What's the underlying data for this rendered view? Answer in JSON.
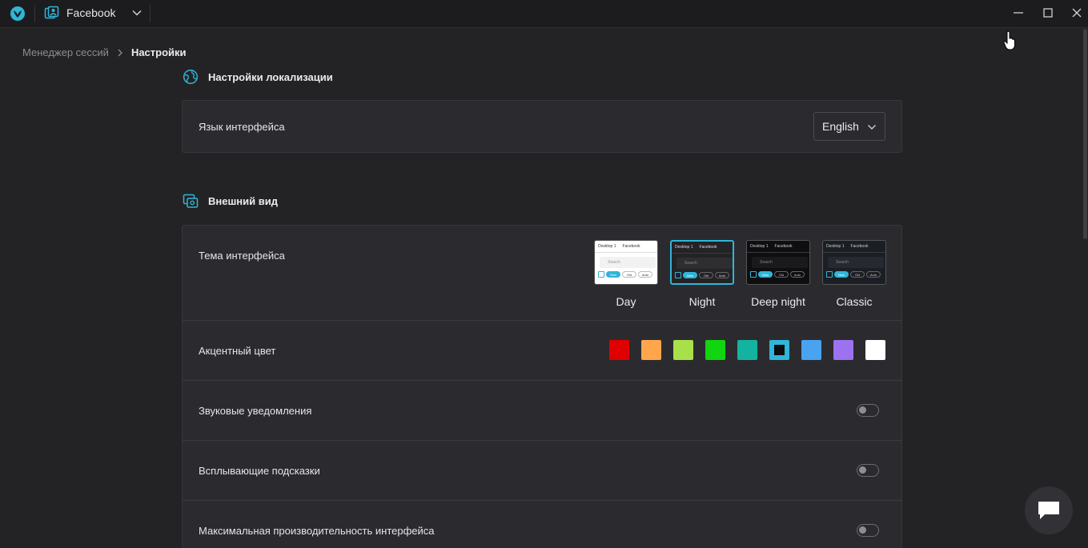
{
  "titlebar": {
    "app_logo_icon": "butterfly-logo-icon",
    "profile_icon": "profile-card-icon",
    "profile_name": "Facebook",
    "window_controls": [
      "minimize-icon",
      "maximize-icon",
      "close-icon"
    ]
  },
  "breadcrumb": {
    "root": "Менеджер сессий",
    "current": "Настройки"
  },
  "localization": {
    "section_title": "Настройки локализации",
    "section_icon": "globe-icon",
    "language_label": "Язык интерфейса",
    "language_value": "English"
  },
  "appearance": {
    "section_title": "Внешний вид",
    "section_icon": "display-settings-icon",
    "theme_label": "Тема интерфейса",
    "theme_preview": {
      "tab": "Desktop 1",
      "profile": "Facebook",
      "search": "Search",
      "chips": [
        "New",
        "Old",
        "Auto"
      ]
    },
    "themes": [
      {
        "name": "Day",
        "selected": false,
        "bg": "#ffffff",
        "fg": "#333333"
      },
      {
        "name": "Night",
        "selected": true,
        "bg": "#232326",
        "fg": "#dddddd"
      },
      {
        "name": "Deep night",
        "selected": false,
        "bg": "#0e0e10",
        "fg": "#cccccc"
      },
      {
        "name": "Classic",
        "selected": false,
        "bg": "#1b1e24",
        "fg": "#cccccc"
      }
    ],
    "accent_label": "Акцентный цвет",
    "accent_colors": [
      {
        "color": "#e00000",
        "selected": false
      },
      {
        "color": "#ffa64d",
        "selected": false
      },
      {
        "color": "#a8e04a",
        "selected": false
      },
      {
        "color": "#10d510",
        "selected": false
      },
      {
        "color": "#14b3a0",
        "selected": false
      },
      {
        "color": "#2fb6d8",
        "selected": true
      },
      {
        "color": "#4aa3f0",
        "selected": false
      },
      {
        "color": "#9b72f0",
        "selected": false
      },
      {
        "color": "#ffffff",
        "selected": false
      }
    ],
    "sound_label": "Звуковые уведомления",
    "sound_enabled": false,
    "tooltips_label": "Всплывающие подсказки",
    "tooltips_enabled": false,
    "performance_label": "Максимальная производительность интерфейса",
    "performance_enabled": false
  },
  "chat_button_icon": "chat-bubble-icon",
  "colors": {
    "accent": "#2fb6d8",
    "background": "#232326",
    "card": "#2b2b2f"
  }
}
